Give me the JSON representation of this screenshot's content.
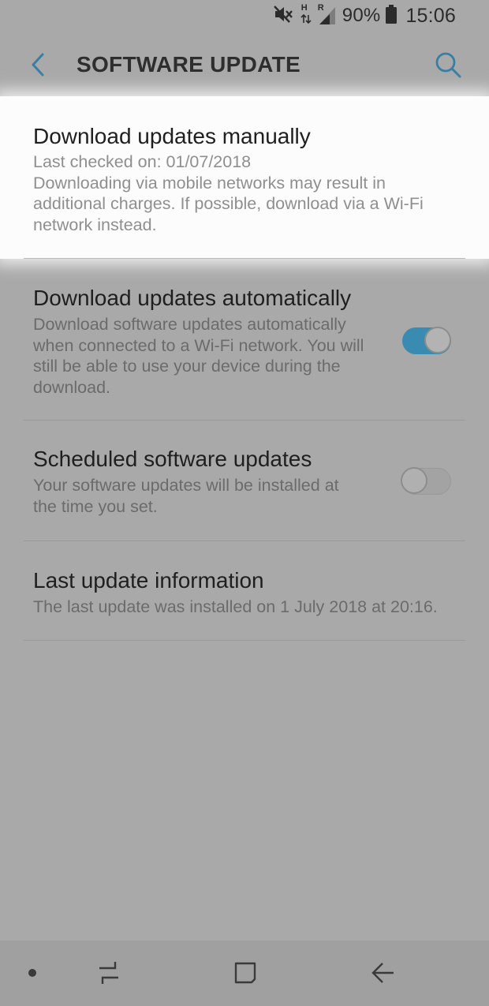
{
  "status_bar": {
    "network_h": "H",
    "network_r": "R",
    "battery": "90%",
    "time": "15:06",
    "icons": [
      "mute-icon",
      "data-arrows-icon",
      "signal-icon",
      "battery-icon"
    ]
  },
  "app_bar": {
    "title": "SOFTWARE UPDATE",
    "back_icon": "back-arrow-icon",
    "search_icon": "search-icon"
  },
  "settings": [
    {
      "title": "Download updates manually",
      "lines": [
        "Last checked on: 01/07/2018",
        "Downloading via mobile networks may result in additional charges. If possible, download via a Wi-Fi network instead."
      ],
      "highlighted": true
    },
    {
      "title": "Download updates automatically",
      "lines": [
        "Download software updates automatically when connected to a Wi-Fi network. You will still be able to use your device during the download."
      ],
      "toggle": true,
      "toggle_on": true
    },
    {
      "title": "Scheduled software updates",
      "lines": [
        "Your software updates will be installed at the time you set."
      ],
      "toggle": true,
      "toggle_on": false
    },
    {
      "title": "Last update information",
      "lines": [
        "The last update was installed on 1 July 2018 at 20:16."
      ]
    }
  ],
  "nav_bar": {
    "items": [
      "dot-icon",
      "recent-apps-icon",
      "home-icon",
      "back-icon"
    ]
  },
  "colors": {
    "accent": "#3a8bb1",
    "dim_background": "#a9a9a9",
    "highlight_background": "#fcfcfc"
  }
}
